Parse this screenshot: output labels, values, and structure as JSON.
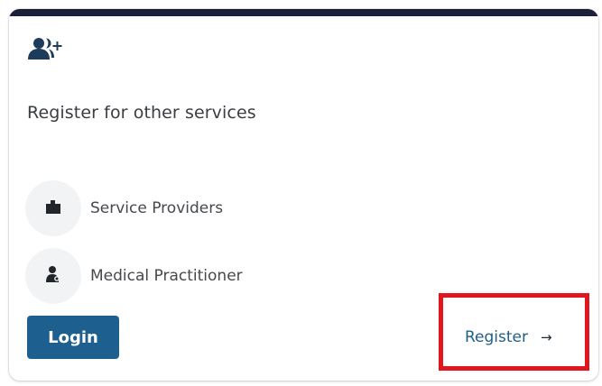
{
  "card": {
    "title": "Register for other services",
    "header_icon": "user-plus-icon"
  },
  "services": [
    {
      "label": "Service Providers",
      "icon": "building-icon"
    },
    {
      "label": "Medical Practitioner",
      "icon": "doctor-icon"
    }
  ],
  "actions": {
    "login_label": "Login",
    "register_label": "Register",
    "register_icon": "arrow-right-icon",
    "register_arrow": "→"
  },
  "colors": {
    "top_bar": "#1a2138",
    "primary": "#1d5f8f",
    "link": "#1f5f86",
    "highlight": "#e3161f",
    "icon": "#1d3c5c"
  }
}
